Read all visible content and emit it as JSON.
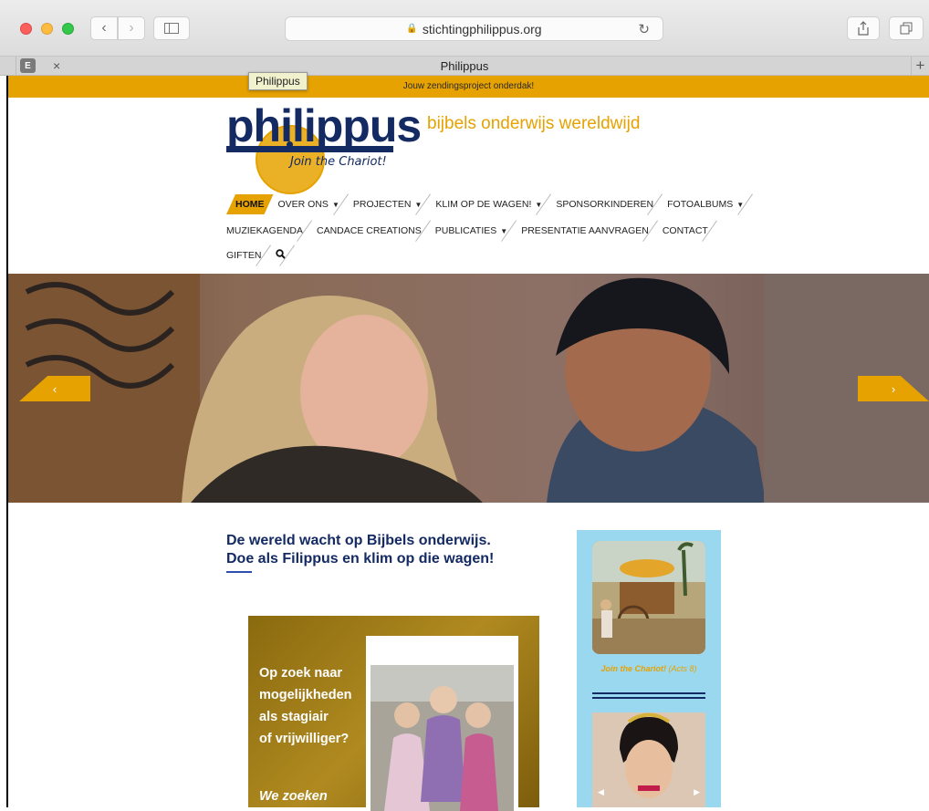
{
  "browser": {
    "url": "stichtingphilippus.org",
    "tab_title": "Philippus",
    "pinned_tab_letter": "E",
    "tab_close": "×",
    "new_tab": "+",
    "back": "‹",
    "forward": "›",
    "reload": "↻",
    "tooltip": "Philippus"
  },
  "site": {
    "promo_bar": "Jouw zendingsproject onderdak!",
    "logo_text": "philippus",
    "logo_tag": "Join the Chariot!",
    "tagline": "bijbels onderwijs wereldwijd",
    "nav": {
      "row1": [
        "HOME",
        "OVER ONS",
        "PROJECTEN",
        "KLIM OP DE WAGEN!",
        "SPONSORKINDEREN",
        "FOTOALBUMS"
      ],
      "row2": [
        "MUZIEKAGENDA",
        "CANDACE CREATIONS",
        "PUBLICATIES",
        "PRESENTATIE AANVRAGEN",
        "CONTACT"
      ],
      "row3": [
        "GIFTEN"
      ]
    },
    "hero": {
      "prev": "‹",
      "next": "›"
    },
    "headline_1": "De wereld wacht op Bijbels onderwijs.",
    "headline_2": "Doe als Filippus en klim op die wagen!",
    "card": {
      "lines": [
        "Op zoek naar",
        "mogelijkheden",
        "als stagiair",
        "of vrijwilliger?"
      ],
      "more": "We zoeken"
    },
    "sidebar": {
      "caption_bold": "Join the Chariot!",
      "caption_rest": " (Acts 8)"
    }
  },
  "colors": {
    "accent": "#e6a200",
    "navy": "#132a63",
    "sidebar": "#99d8ef"
  }
}
